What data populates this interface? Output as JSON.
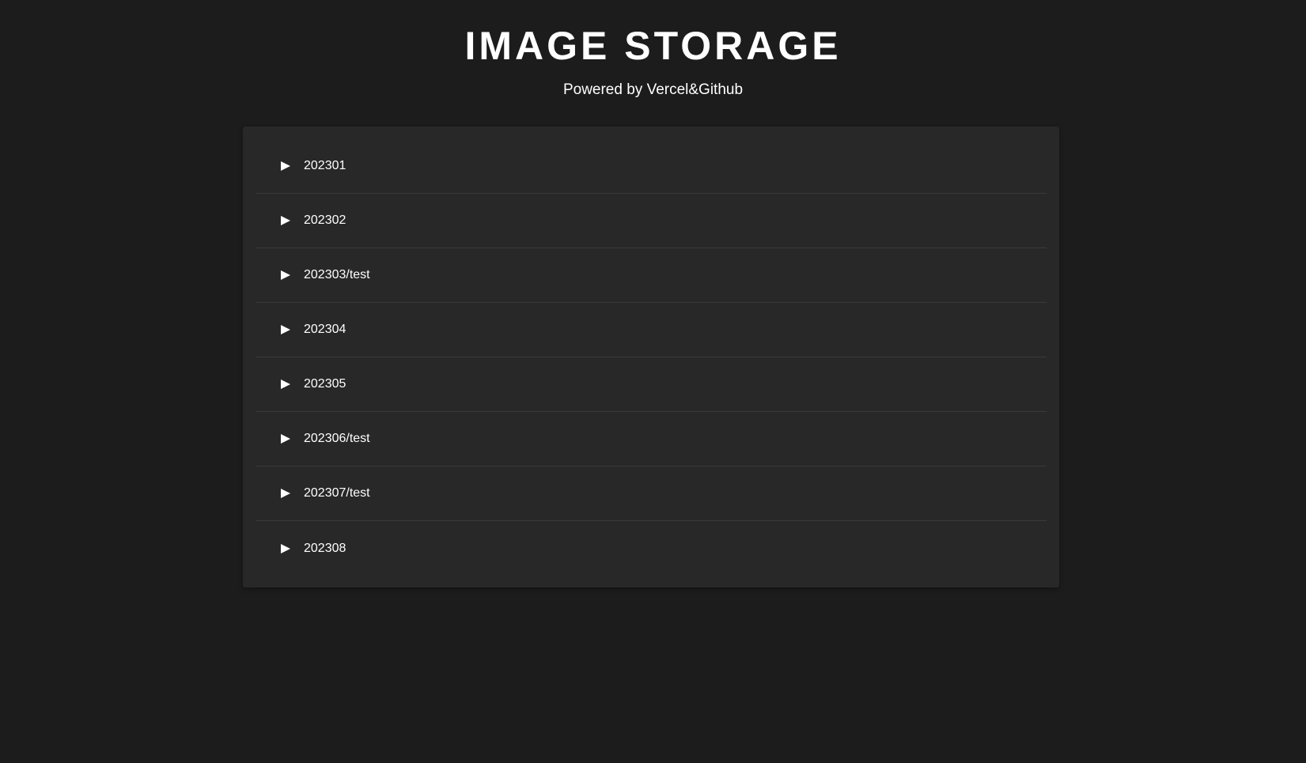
{
  "header": {
    "title": "IMAGE STORAGE",
    "subtitle": "Powered by Vercel&Github"
  },
  "folders": [
    {
      "label": "202301",
      "icon": "play-triangle-icon"
    },
    {
      "label": "202302",
      "icon": "play-triangle-icon"
    },
    {
      "label": "202303/test",
      "icon": "play-triangle-icon"
    },
    {
      "label": "202304",
      "icon": "play-triangle-icon"
    },
    {
      "label": "202305",
      "icon": "play-triangle-icon"
    },
    {
      "label": "202306/test",
      "icon": "play-triangle-icon"
    },
    {
      "label": "202307/test",
      "icon": "play-triangle-icon"
    },
    {
      "label": "202308",
      "icon": "play-triangle-icon"
    }
  ],
  "colors": {
    "background": "#1c1c1c",
    "panel": "#282828",
    "divider": "#3a3a3a",
    "text": "#ffffff"
  }
}
